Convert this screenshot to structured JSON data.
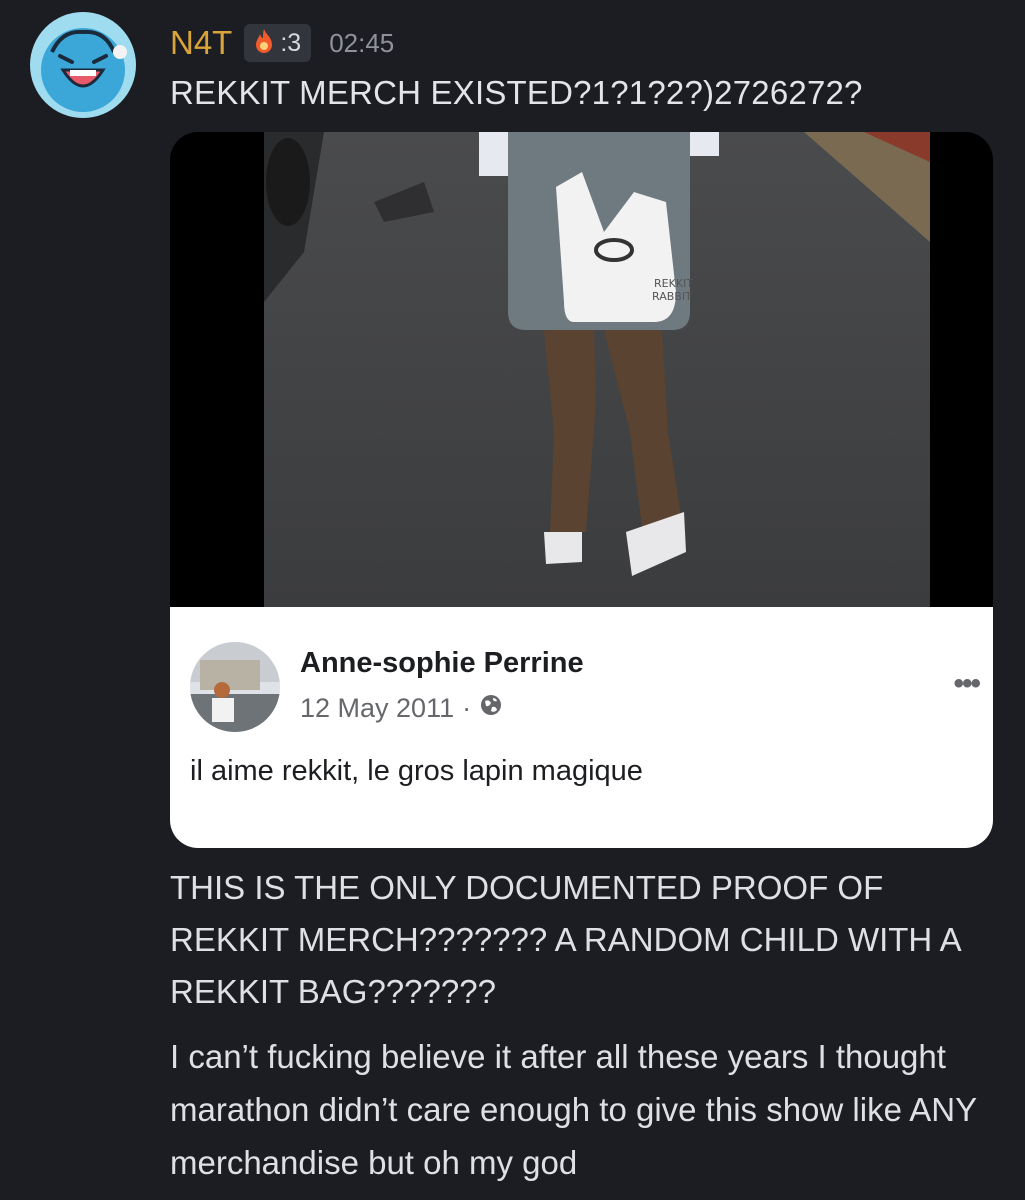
{
  "message": {
    "author": "N4T",
    "tag_text": ":3",
    "tag_icon": "fire-icon",
    "time": "02:45",
    "text": "REKKIT MERCH EXISTED?1?1?2?)2726272?"
  },
  "embed": {
    "photo_bag_text_line1": "REKKIT",
    "photo_bag_text_line2": "RABBIT",
    "post": {
      "author": "Anne-sophie Perrine",
      "date": "12 May 2011",
      "separator": "·",
      "visibility_icon": "globe-icon",
      "more_label": "•••",
      "text": "il aime rekkit, le gros lapin magique"
    }
  },
  "followups": [
    "THIS IS THE ONLY DOCUMENTED PROOF OF REKKIT MERCH??????? A RANDOM CHILD WITH A REKKIT BAG???????",
    "I can’t fucking believe it after all these years I thought marathon didn’t care enough to give this show like ANY merchandise but oh my god"
  ],
  "colors": {
    "background": "#1c1d22",
    "username": "#d9a43a",
    "timestamp": "#8f929b"
  }
}
